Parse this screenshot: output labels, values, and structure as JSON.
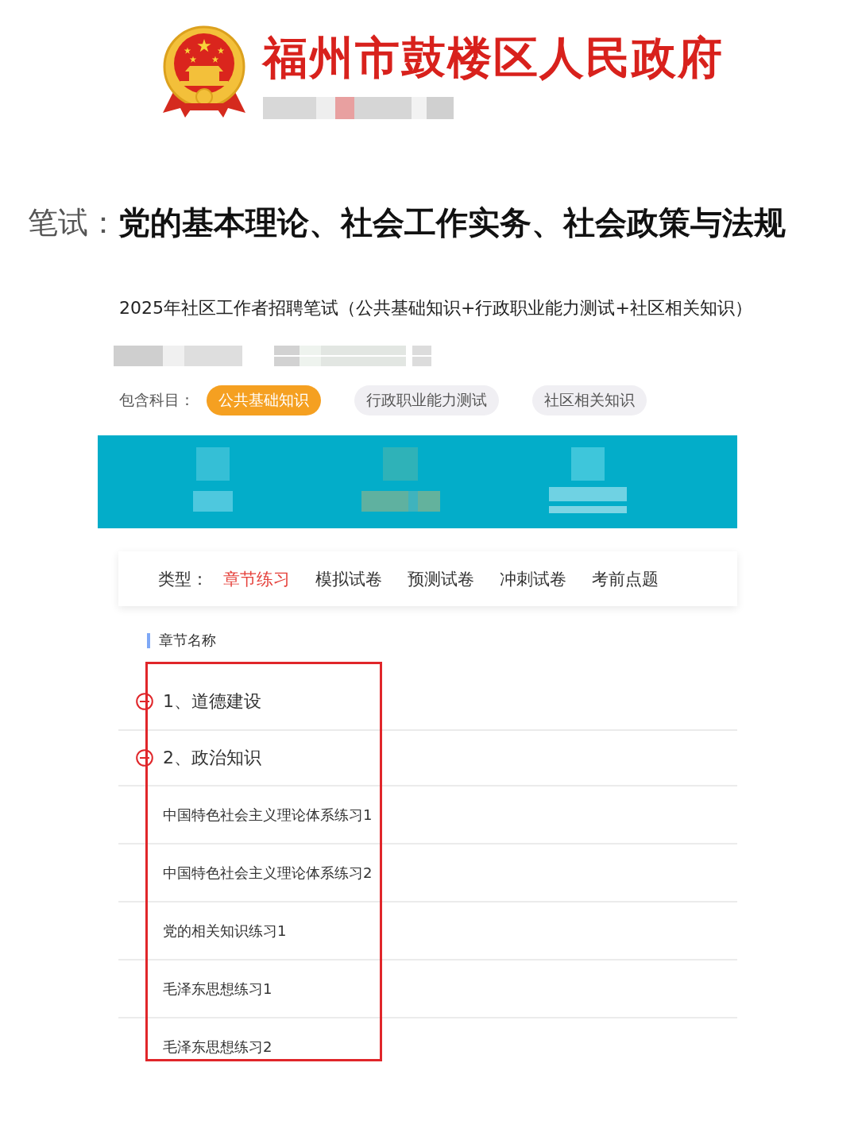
{
  "header": {
    "title": "福州市鼓楼区人民政府"
  },
  "exam_line": {
    "label": "笔试：",
    "subjects": "党的基本理论、社会工作实务、社会政策与法规"
  },
  "course": {
    "title": "2025年社区工作者招聘笔试（公共基础知识+行政职业能力测试+社区相关知识）",
    "subjects_label": "包含科目：",
    "subjects": [
      {
        "label": "公共基础知识",
        "selected": true
      },
      {
        "label": "行政职业能力测试",
        "selected": false
      },
      {
        "label": "社区相关知识",
        "selected": false
      }
    ]
  },
  "type_bar": {
    "label": "类型：",
    "tabs": [
      {
        "label": "章节练习",
        "selected": true
      },
      {
        "label": "模拟试卷",
        "selected": false
      },
      {
        "label": "预测试卷",
        "selected": false
      },
      {
        "label": "冲刺试卷",
        "selected": false
      },
      {
        "label": "考前点题",
        "selected": false
      }
    ]
  },
  "chapters": {
    "heading": "章节名称",
    "items": [
      {
        "label": "1、道德建设"
      },
      {
        "label": "2、政治知识",
        "children": [
          {
            "label": "中国特色社会主义理论体系练习1"
          },
          {
            "label": "中国特色社会主义理论体系练习2"
          },
          {
            "label": "党的相关知识练习1"
          },
          {
            "label": "毛泽东思想练习1"
          },
          {
            "label": "毛泽东思想练习2"
          }
        ]
      }
    ]
  }
}
